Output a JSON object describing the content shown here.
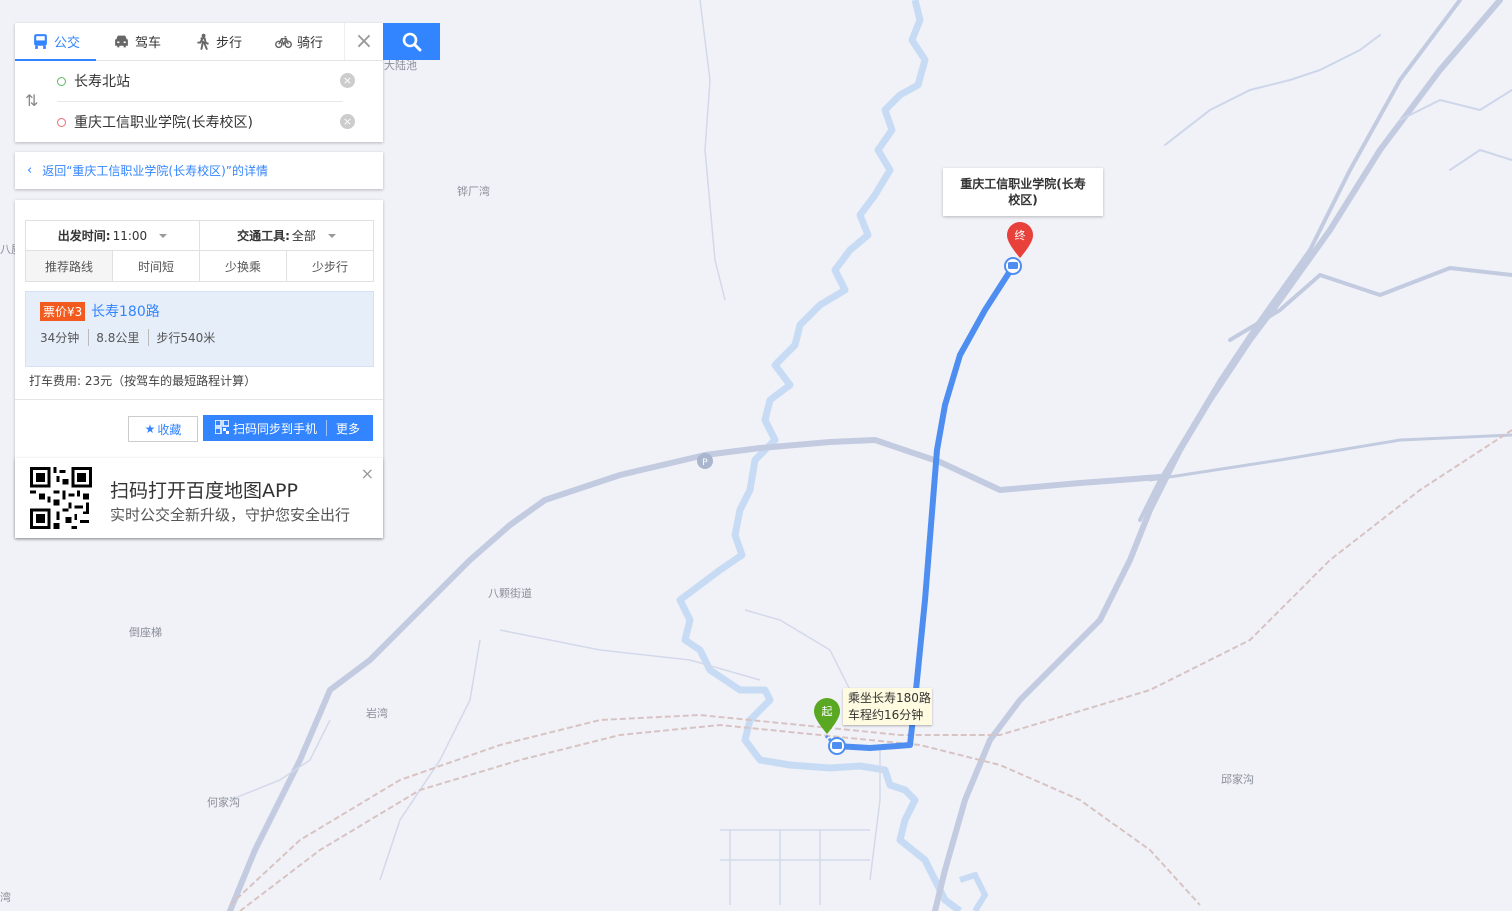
{
  "modes": [
    {
      "label": "公交",
      "icon": "bus-icon",
      "active": true
    },
    {
      "label": "驾车",
      "icon": "car-icon",
      "active": false
    },
    {
      "label": "步行",
      "icon": "walk-icon",
      "active": false
    },
    {
      "label": "骑行",
      "icon": "bike-icon",
      "active": false
    }
  ],
  "route": {
    "start": "长寿北站",
    "end": "重庆工信职业学院(长寿校区)"
  },
  "back_link": "返回“重庆工信职业学院(长寿校区)”的详情",
  "filters": {
    "depart_label": "出发时间:",
    "depart_value": "11:00",
    "vehicle_label": "交通工具:",
    "vehicle_value": "全部",
    "tabs": [
      "推荐路线",
      "时间短",
      "少换乘",
      "少步行"
    ]
  },
  "plan": {
    "fare": "票价¥3",
    "line": "长寿180路",
    "duration": "34分钟",
    "distance": "8.8公里",
    "walk": "步行540米"
  },
  "taxi": "打车费用: 23元（按驾车的最短路程计算）",
  "buttons": {
    "favorite": "收藏",
    "sync": "扫码同步到手机",
    "more": "更多"
  },
  "promo": {
    "title": "扫码打开百度地图APP",
    "subtitle": "实时公交全新升级，守护您安全出行"
  },
  "map": {
    "destination": "重庆工信职业学院(长寿校区)",
    "end_marker": "终",
    "start_marker": "起",
    "ride_line1": "乘坐长寿180路",
    "ride_line2": "车程约16分钟",
    "labels": [
      {
        "id": "tiechangwan",
        "text": "铧厂湾"
      },
      {
        "id": "bakejiedao",
        "text": "八颗街道"
      },
      {
        "id": "daozuoti",
        "text": "倒座梯"
      },
      {
        "id": "yanwan",
        "text": "岩湾"
      },
      {
        "id": "hejiagou",
        "text": "何家沟"
      },
      {
        "id": "qiujiagou",
        "text": "邱家沟"
      },
      {
        "id": "dalu",
        "text": "大陆池"
      },
      {
        "id": "bawu",
        "text": "八屋"
      },
      {
        "id": "wan",
        "text": "湾"
      }
    ]
  },
  "colors": {
    "accent": "#3385ff",
    "fare": "#f25b1d",
    "route": "#4d8ef0",
    "river": "#bcd9f5",
    "road": "#bfc8de"
  }
}
